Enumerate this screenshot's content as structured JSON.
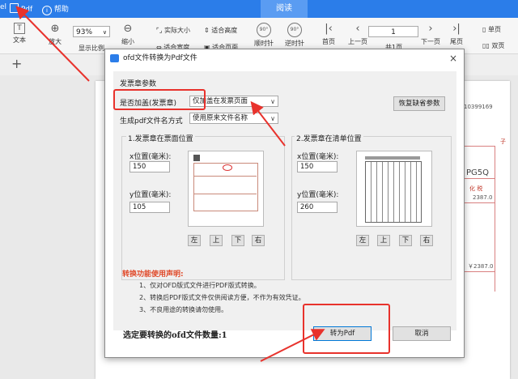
{
  "topbar": {
    "left_fragment": "el",
    "pdf_label": "Pdf",
    "help_label": "帮助",
    "read_tab": "阅读"
  },
  "toolbar": {
    "text_label": "文本",
    "zoom_in_label": "放大",
    "zoom_value": "93%",
    "display_ratio_label": "显示比例",
    "zoom_out_label": "缩小",
    "actual_size_label": "实际大小",
    "fit_height_label": "适合高度",
    "fit_width_label": "适合宽度",
    "fit_page_label": "适合页面",
    "rotate_cw_label": "顺时针",
    "rotate_ccw_label": "逆时针",
    "first_page_label": "首页",
    "prev_page_label": "上一页",
    "page_value": "1",
    "total_label": "共1页",
    "next_page_label": "下一页",
    "last_page_label": "尾页",
    "single_page_label": "单页",
    "double_page_label": "双页"
  },
  "tabs": {
    "add_tab_label": "+"
  },
  "document": {
    "number": "10399169",
    "code": "PG5Q",
    "red_chars": "化  税",
    "amount1": "2387.0",
    "amount2": "￥2387.0",
    "side_mark": "子"
  },
  "dialog": {
    "title": "ofd文件转换为Pdf文件",
    "close": "×",
    "section_title": "发票章参数",
    "stamp_label": "是否加盖(发票章)",
    "stamp_select": "仅加盖在发票页面",
    "filename_label": "生成pdf文件名方式",
    "filename_select": "使用原来文件名称",
    "restore_button": "恢复缺省参数",
    "group1": {
      "title": "1.发票章在票面位置",
      "x_label": "x位置(毫米):",
      "x_value": "150",
      "y_label": "y位置(毫米):",
      "y_value": "105"
    },
    "group2": {
      "title": "2.发票章在清单位置",
      "x_label": "x位置(毫米):",
      "x_value": "150",
      "y_label": "y位置(毫米):",
      "y_value": "260"
    },
    "dir_buttons": {
      "left": "左",
      "up": "上",
      "down": "下",
      "right": "右"
    },
    "notes_title": "转换功能使用声明:",
    "notes": [
      "1、仅对OFD版式文件进行PDF版式转换。",
      "2、转换后PDF版式文件仅供阅读方便，不作为有效凭证。",
      "3、不良用途的转换请勿使用。"
    ],
    "count_label": "选定要转换的ofd文件数量:1",
    "convert_button": "转为Pdf",
    "cancel_button": "取消"
  },
  "colors": {
    "accent": "#2b7de9",
    "highlight": "#e8322c",
    "notice": "#e04a2a"
  }
}
